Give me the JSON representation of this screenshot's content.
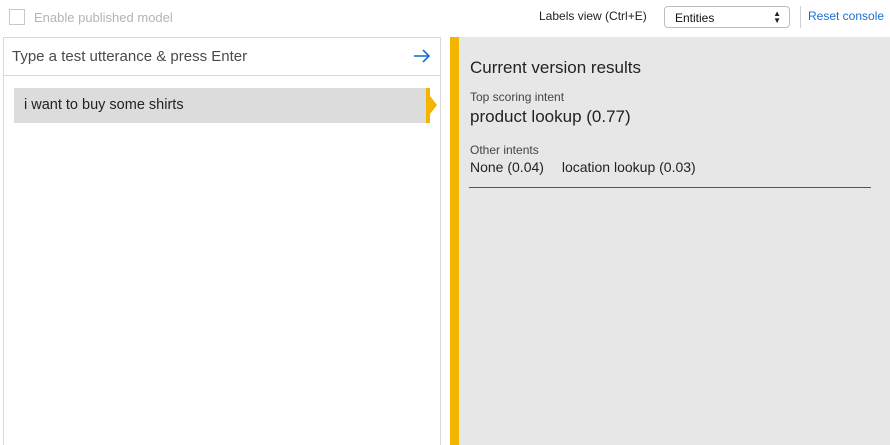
{
  "topbar": {
    "enable_published_label": "Enable published model",
    "labels_view_label": "Labels view (Ctrl+E)",
    "labels_view_selected": "Entities",
    "reset_console_label": "Reset console"
  },
  "test_panel": {
    "input_placeholder": "Type a test utterance & press Enter",
    "input_value": "",
    "utterances": [
      {
        "text": "i want to buy some shirts",
        "selected": true
      }
    ]
  },
  "results_panel": {
    "title": "Current version results",
    "top_scoring_label": "Top scoring intent",
    "top_scoring_value": "product lookup (0.77)",
    "other_intents_label": "Other intents",
    "other_intents": [
      "None (0.04)",
      "location lookup (0.03)"
    ]
  },
  "colors": {
    "accent": "#f5b400",
    "link": "#1b6fd1",
    "results_background": "#e7e7e7",
    "selected_item_background": "#dcdcdc"
  },
  "icons": {
    "submit": "arrow-right-icon",
    "select": "chevron-up-down-icon"
  }
}
